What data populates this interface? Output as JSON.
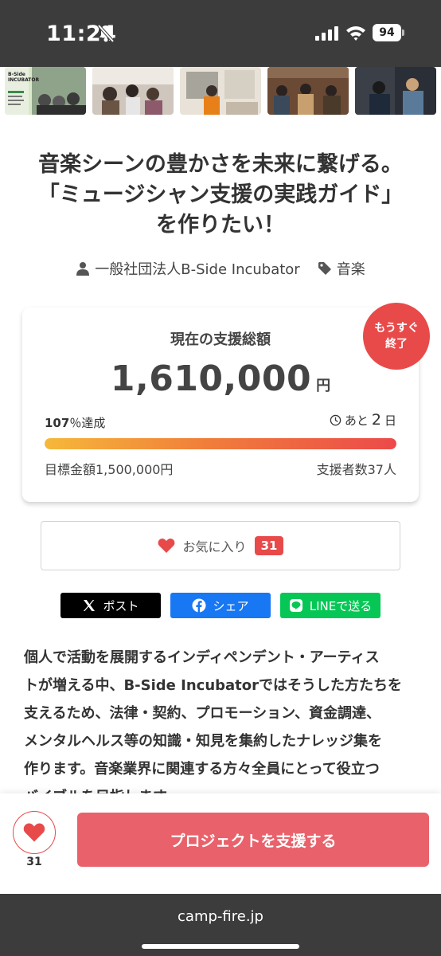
{
  "status_bar": {
    "time": "11:24",
    "battery": "94",
    "icons": [
      "bell-slash-icon",
      "signal-icon",
      "wifi-icon",
      "battery-icon"
    ]
  },
  "gallery": {
    "thumbnails": [
      {
        "label_line1": "B-Side",
        "label_line2": "INCUBATOR"
      },
      {},
      {},
      {},
      {}
    ]
  },
  "project": {
    "title_lines": [
      "音楽シーンの豊かさを未来に繋げる。",
      "「ミュージシャン支援の実践ガイド」",
      "を作りたい！"
    ],
    "owner": "一般社団法人B-Side Incubator",
    "category": "音楽"
  },
  "funding": {
    "label": "現在の支援総額",
    "amount": "1,610,000",
    "unit": "円",
    "rate_number": "107",
    "rate_suffix": "％達成",
    "days_prefix": "あと",
    "days_number": "2",
    "days_suffix": "日",
    "progress_percent": 100,
    "goal": "目標金額1,500,000円",
    "backers": "支援者数37人",
    "badge_line1": "もうすぐ",
    "badge_line2": "終了"
  },
  "favorite": {
    "label": "お気に入り",
    "count": "31"
  },
  "share": {
    "x_label": "ポスト",
    "facebook_label": "シェア",
    "line_label": "LINEで送る"
  },
  "description_lines": [
    "個人で活動を展開するインディペンデント・アーティス",
    "トが増える中、B-Side Incubatorではそうした方たちを",
    "支えるため、法律・契約、プロモーション、資金調達、",
    "メンタルヘルス等の知識・知見を集約したナレッジ集を",
    "作ります。音楽業界に関連する方々全員にとって役立つ",
    "バイブルを目指します。"
  ],
  "action_bar": {
    "favorite_count": "31",
    "support_label": "プロジェクトを支援する"
  },
  "browser": {
    "url": "camp-fire.jp"
  },
  "colors": {
    "accent": "#e84a4a",
    "support_button": "#e9616a",
    "progress_start": "#f6b83a",
    "progress_end": "#ec4a4a",
    "facebook": "#1877f2",
    "line": "#06c755"
  }
}
